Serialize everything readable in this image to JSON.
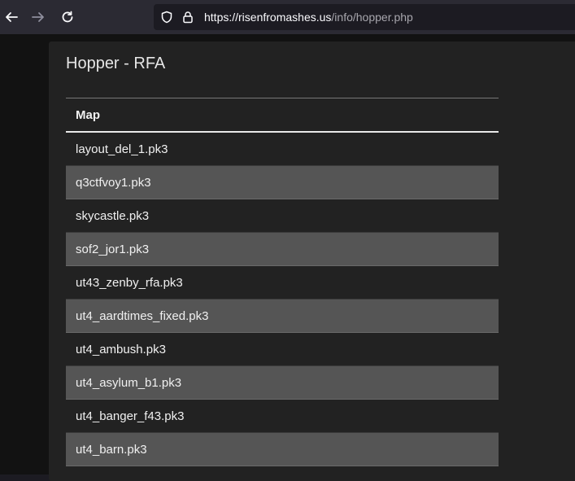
{
  "browser": {
    "url_host": "https://risenfromashes.us",
    "url_path": "/info/hopper.php"
  },
  "page": {
    "title": "Hopper - RFA"
  },
  "table": {
    "header": "Map",
    "rows": [
      "layout_del_1.pk3",
      "q3ctfvoy1.pk3",
      "skycastle.pk3",
      "sof2_jor1.pk3",
      "ut43_zenby_rfa.pk3",
      "ut4_aardtimes_fixed.pk3",
      "ut4_ambush.pk3",
      "ut4_asylum_b1.pk3",
      "ut4_banger_f43.pk3",
      "ut4_barn.pk3"
    ]
  }
}
